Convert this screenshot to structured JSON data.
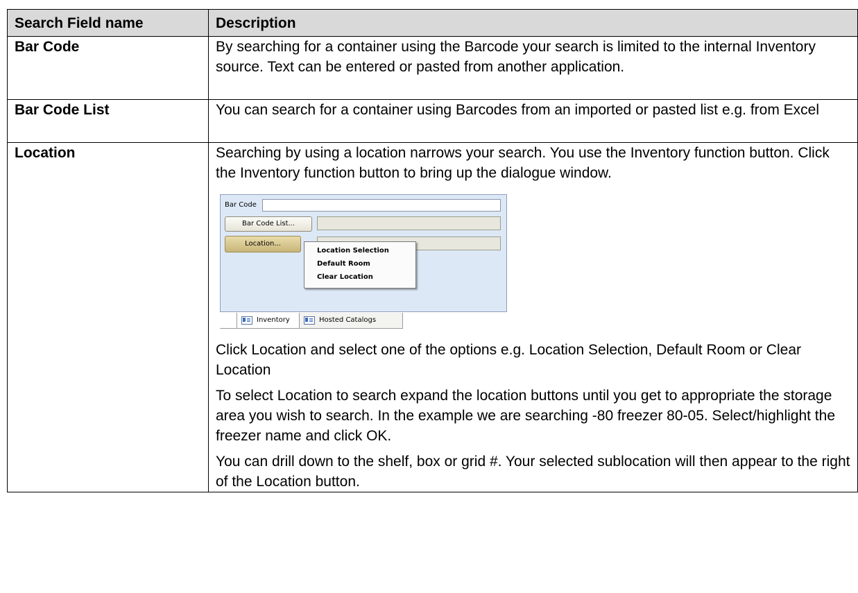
{
  "table": {
    "headers": [
      "Search Field name",
      "Description"
    ],
    "rows": [
      {
        "field": "Bar Code",
        "description": "By searching for a container using the Barcode your search is limited to the internal Inventory source. Text can be entered or pasted from another application."
      },
      {
        "field": "Bar Code List",
        "description": "You can search for a container using Barcodes from an imported or pasted list e.g. from Excel"
      },
      {
        "field": "Location",
        "paragraphs": [
          "Searching by using a location narrows your search. You use the Inventory function button. Click the Inventory function button to bring up the dialogue window.",
          "Click Location and select one of the options e.g.  Location Selection, Default Room or Clear Location",
          "To select Location to search expand the location buttons until you get to appropriate the storage area you wish to search. In the example we are searching -80 freezer 80-05. Select/highlight the freezer name and click OK.",
          "You can drill down to the shelf, box or grid #. Your selected sublocation will then appear to the right of the Location button."
        ]
      }
    ]
  },
  "screenshot": {
    "bar_code_label": "Bar Code",
    "bar_code_list_button": "Bar Code List...",
    "location_button": "Location...",
    "menu_items": [
      "Location Selection",
      "Default Room",
      "Clear Location"
    ],
    "tabs": [
      {
        "label": "Inventory",
        "icon": "window-icon"
      },
      {
        "label": "Hosted Catalogs",
        "icon": "window-icon"
      }
    ],
    "colors": {
      "panel": "#dde8f7",
      "active_button": "#c8b57a"
    }
  }
}
